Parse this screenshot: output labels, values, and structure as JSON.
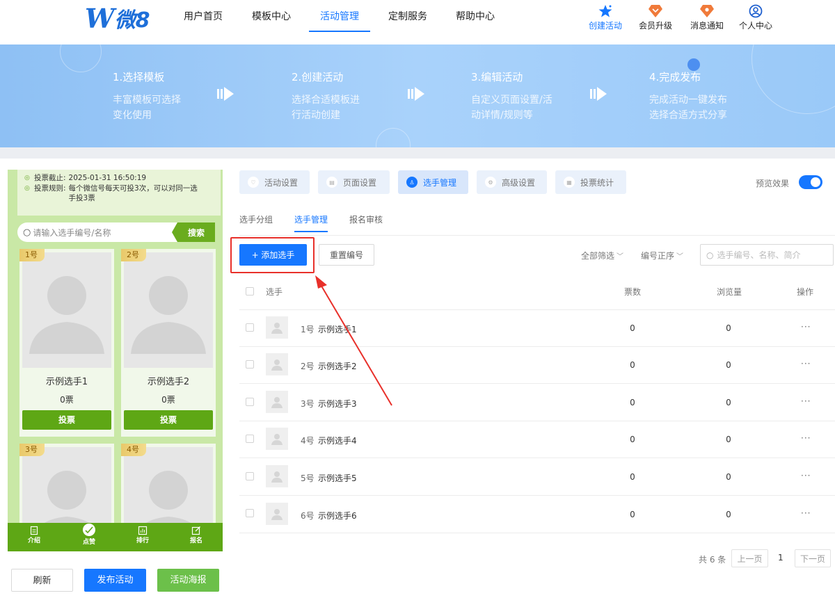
{
  "logo": {
    "mark": "W",
    "text": "微8"
  },
  "nav": {
    "items": [
      "用户首页",
      "模板中心",
      "活动管理",
      "定制服务",
      "帮助中心"
    ],
    "active_index": 2,
    "actions": [
      {
        "label": "创建活动",
        "icon": "star-icon"
      },
      {
        "label": "会员升级",
        "icon": "vip-icon"
      },
      {
        "label": "消息通知",
        "icon": "notification-icon"
      },
      {
        "label": "个人中心",
        "icon": "user-icon"
      }
    ]
  },
  "banner": {
    "steps": [
      {
        "title": "1.选择模板",
        "desc": "丰富模板可选择变化使用"
      },
      {
        "title": "2.创建活动",
        "desc": "选择合适模板进行活动创建"
      },
      {
        "title": "3.编辑活动",
        "desc": "自定义页面设置/活动详情/规则等"
      },
      {
        "title": "4.完成发布",
        "desc": "完成活动一键发布选择合适方式分享"
      }
    ]
  },
  "phone": {
    "deadline_label": "投票截止:",
    "deadline_value": "2025-01-31 16:50:19",
    "rule_label": "投票规则:",
    "rule_value": "每个微信号每天可投3次，可以对同一选手投3票",
    "search_placeholder": "请输入选手编号/名称",
    "search_button": "搜索",
    "cards": [
      {
        "num": "1号",
        "name": "示例选手1",
        "votes": "0票",
        "button": "投票"
      },
      {
        "num": "2号",
        "name": "示例选手2",
        "votes": "0票",
        "button": "投票"
      },
      {
        "num": "3号"
      },
      {
        "num": "4号"
      }
    ],
    "tabs": [
      "介绍",
      "点赞",
      "排行",
      "报名"
    ]
  },
  "bottom_buttons": {
    "refresh": "刷新",
    "publish": "发布活动",
    "poster": "活动海报"
  },
  "settings_tabs": [
    "活动设置",
    "页面设置",
    "选手管理",
    "高级设置",
    "投票统计"
  ],
  "settings_active_index": 2,
  "preview": {
    "label": "预览效果",
    "enabled": true
  },
  "sub_tabs": [
    "选手分组",
    "选手管理",
    "报名审核"
  ],
  "sub_active_index": 1,
  "toolbar": {
    "add_label": "+ 添加选手",
    "reset_label": "重置编号",
    "filter_all": "全部筛选",
    "sort": "编号正序",
    "search_placeholder": "选手编号、名称、简介"
  },
  "table": {
    "headers": {
      "player": "选手",
      "votes": "票数",
      "views": "浏览量",
      "actions": "操作"
    },
    "rows": [
      {
        "num": "1号",
        "name": "示例选手1",
        "votes": "0",
        "views": "0",
        "more": "···"
      },
      {
        "num": "2号",
        "name": "示例选手2",
        "votes": "0",
        "views": "0",
        "more": "···"
      },
      {
        "num": "3号",
        "name": "示例选手3",
        "votes": "0",
        "views": "0",
        "more": "···"
      },
      {
        "num": "4号",
        "name": "示例选手4",
        "votes": "0",
        "views": "0",
        "more": "···"
      },
      {
        "num": "5号",
        "name": "示例选手5",
        "votes": "0",
        "views": "0",
        "more": "···"
      },
      {
        "num": "6号",
        "name": "示例选手6",
        "votes": "0",
        "views": "0",
        "more": "···"
      }
    ]
  },
  "pagination": {
    "total": "共 6 条",
    "prev": "上一页",
    "current": "1",
    "next": "下一页"
  },
  "colors": {
    "primary": "#1677ff",
    "vote_green": "#5ea715",
    "highlight_red": "#e8302a"
  }
}
